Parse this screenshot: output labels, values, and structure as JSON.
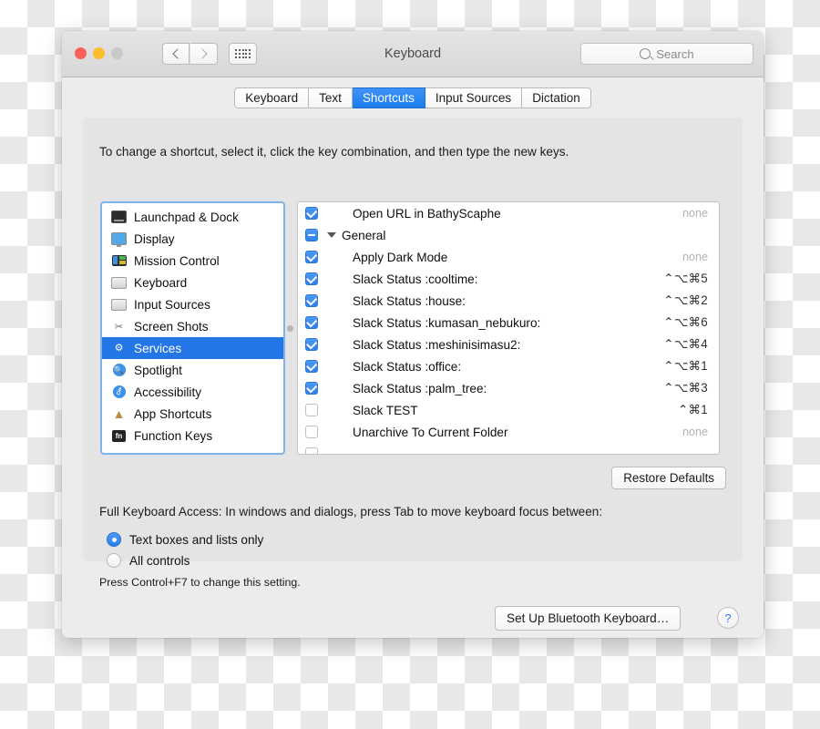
{
  "window": {
    "title": "Keyboard",
    "traffic_lights": [
      "close",
      "minimize",
      "zoom"
    ],
    "back_label": "Back",
    "forward_label": "Forward",
    "grid_label": "Show All"
  },
  "search": {
    "placeholder": "Search",
    "value": ""
  },
  "tabs": [
    {
      "label": "Keyboard",
      "active": false
    },
    {
      "label": "Text",
      "active": false
    },
    {
      "label": "Shortcuts",
      "active": true
    },
    {
      "label": "Input Sources",
      "active": false
    },
    {
      "label": "Dictation",
      "active": false
    }
  ],
  "hint": "To change a shortcut, select it, click the key combination, and then type the new keys.",
  "categories": [
    {
      "label": "Launchpad & Dock",
      "icon": "monitor-dark-icon",
      "selected": false
    },
    {
      "label": "Display",
      "icon": "display-icon",
      "selected": false
    },
    {
      "label": "Mission Control",
      "icon": "mission-control-icon",
      "selected": false
    },
    {
      "label": "Keyboard",
      "icon": "keyboard-icon",
      "selected": false
    },
    {
      "label": "Input Sources",
      "icon": "keyboard-icon",
      "selected": false
    },
    {
      "label": "Screen Shots",
      "icon": "scissors-icon",
      "selected": false
    },
    {
      "label": "Services",
      "icon": "gear-icon",
      "selected": true
    },
    {
      "label": "Spotlight",
      "icon": "magnifier-icon",
      "selected": false
    },
    {
      "label": "Accessibility",
      "icon": "accessibility-icon",
      "selected": false
    },
    {
      "label": "App Shortcuts",
      "icon": "compass-icon",
      "selected": false
    },
    {
      "label": "Function Keys",
      "icon": "fn-icon",
      "selected": false
    }
  ],
  "shortcuts": [
    {
      "label": "Open URL in BathyScaphe",
      "key": "none",
      "state": "on",
      "group": false,
      "none": true
    },
    {
      "label": "General",
      "key": "",
      "state": "mixed",
      "group": true,
      "none": false
    },
    {
      "label": "Apply Dark Mode",
      "key": "none",
      "state": "on",
      "group": false,
      "none": true
    },
    {
      "label": "Slack Status :cooltime:",
      "key": "⌃⌥⌘5",
      "state": "on",
      "group": false,
      "none": false
    },
    {
      "label": "Slack Status :house:",
      "key": "⌃⌥⌘2",
      "state": "on",
      "group": false,
      "none": false
    },
    {
      "label": "Slack Status :kumasan_nebukuro:",
      "key": "⌃⌥⌘6",
      "state": "on",
      "group": false,
      "none": false
    },
    {
      "label": "Slack Status :meshinisimasu2:",
      "key": "⌃⌥⌘4",
      "state": "on",
      "group": false,
      "none": false
    },
    {
      "label": "Slack Status :office:",
      "key": "⌃⌥⌘1",
      "state": "on",
      "group": false,
      "none": false
    },
    {
      "label": "Slack Status :palm_tree:",
      "key": "⌃⌥⌘3",
      "state": "on",
      "group": false,
      "none": false
    },
    {
      "label": "Slack TEST",
      "key": "⌃⌘1",
      "state": "off",
      "group": false,
      "none": false
    },
    {
      "label": "Unarchive To Current Folder",
      "key": "none",
      "state": "off",
      "group": false,
      "none": true
    }
  ],
  "restore_defaults_label": "Restore Defaults",
  "full_keyboard_access": {
    "description": "Full Keyboard Access: In windows and dialogs, press Tab to move keyboard focus between:",
    "options": [
      {
        "label": "Text boxes and lists only",
        "selected": true
      },
      {
        "label": "All controls",
        "selected": false
      }
    ],
    "note": "Press Control+F7 to change this setting."
  },
  "footer": {
    "bluetooth_label": "Set Up Bluetooth Keyboard…",
    "help_label": "?"
  },
  "colors": {
    "accent": "#2476e6",
    "tab_active": "#1a7ced",
    "selection": "#2476e6",
    "checkbox_on": "#2d81ee",
    "window_bg": "#ececec",
    "pane_bg": "#e4e4e4"
  }
}
